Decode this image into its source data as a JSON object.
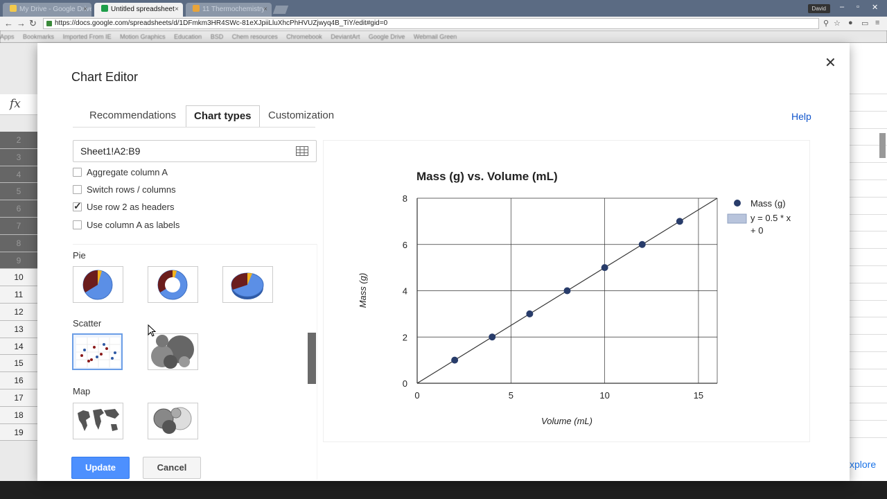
{
  "browser": {
    "tabs": [
      {
        "label": "My Drive - Google Drive",
        "active": false
      },
      {
        "label": "Untitled spreadsheet",
        "active": true
      },
      {
        "label": "11 Thermochemistry",
        "active": false
      }
    ],
    "user_badge": "David",
    "url": "https://docs.google.com/spreadsheets/d/1DFmkm3HR4SWc-81eXJpiiLluXhcPhHVUZjwyq4B_TiY/edit#gid=0",
    "bookmarks": [
      "Apps",
      "Bookmarks",
      "Imported From IE",
      "Motion Graphics",
      "Education",
      "BSD",
      "Chem resources",
      "Chromebook",
      "DeviantArt",
      "Google Drive",
      "Webmail Green"
    ]
  },
  "sheet": {
    "fx_label": "fx",
    "row_numbers": [
      "2",
      "3",
      "4",
      "5",
      "6",
      "7",
      "8",
      "9",
      "10",
      "11",
      "12",
      "13",
      "14",
      "15",
      "16",
      "17",
      "18",
      "19"
    ],
    "explore_label": "xplore"
  },
  "dialog": {
    "title": "Chart Editor",
    "tabs": [
      {
        "label": "Recommendations",
        "active": false
      },
      {
        "label": "Chart types",
        "active": true
      },
      {
        "label": "Customization",
        "active": false
      }
    ],
    "help": "Help",
    "range": "Sheet1!A2:B9",
    "options": [
      {
        "label": "Aggregate column A",
        "checked": false
      },
      {
        "label": "Switch rows / columns",
        "checked": false
      },
      {
        "label": "Use row 2 as headers",
        "checked": true
      },
      {
        "label": "Use column A as labels",
        "checked": false
      }
    ],
    "sections": [
      {
        "label": "Pie",
        "thumbs": [
          "pie-chart",
          "donut-chart",
          "3d-pie-chart"
        ]
      },
      {
        "label": "Scatter",
        "thumbs": [
          "scatter-chart",
          "bubble-chart"
        ]
      },
      {
        "label": "Map",
        "thumbs": [
          "geo-chart",
          "geo-bubble-chart"
        ]
      }
    ],
    "update_label": "Update",
    "cancel_label": "Cancel"
  },
  "colors": {
    "accent": "#4d90fe",
    "series": "#283c6a",
    "pie_blue": "#5b8fe6",
    "pie_dark": "#6b1d1d",
    "pie_gold": "#f2b31e"
  },
  "chart_data": {
    "type": "scatter",
    "title": "Mass (g) vs. Volume (mL)",
    "xlabel": "Volume (mL)",
    "ylabel": "Mass (g)",
    "xlim": [
      0,
      16
    ],
    "ylim": [
      0,
      8
    ],
    "xticks": [
      0,
      5,
      10,
      15
    ],
    "yticks": [
      0,
      2,
      4,
      6,
      8
    ],
    "grid": true,
    "legend_position": "right",
    "series": [
      {
        "name": "Mass (g)",
        "x": [
          2,
          4,
          6,
          8,
          10,
          12,
          14
        ],
        "y": [
          1,
          2,
          3,
          4,
          5,
          6,
          7
        ]
      }
    ],
    "trendline": {
      "label": "y = 0.5 * x + 0",
      "slope": 0.5,
      "intercept": 0
    }
  }
}
